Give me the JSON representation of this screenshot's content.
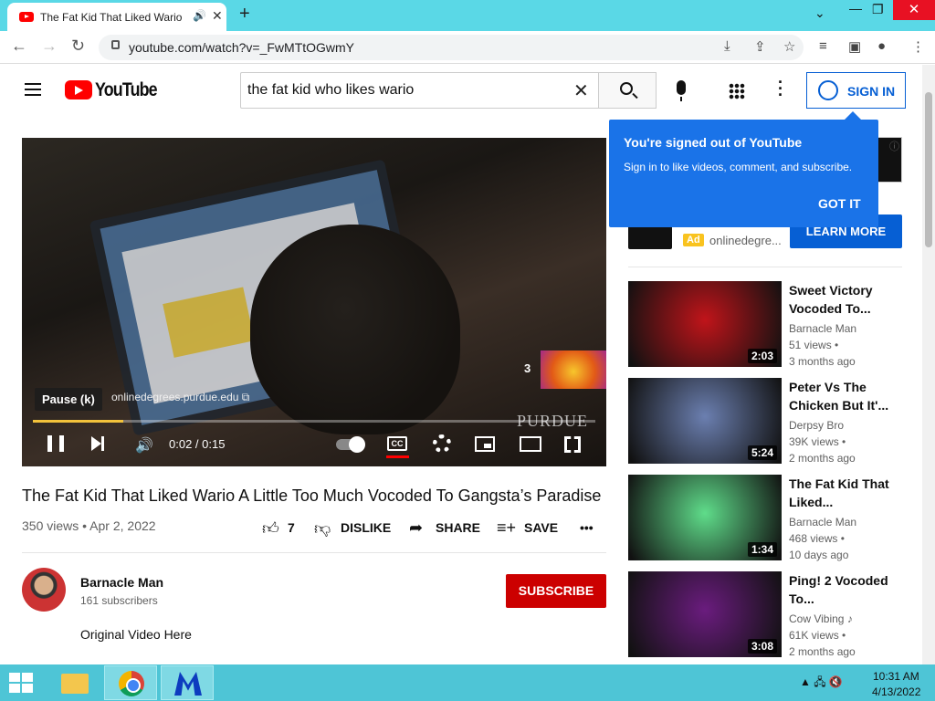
{
  "browser": {
    "tab_title": "The Fat Kid That Liked Wario",
    "tab_audio_icon": "speaker-icon",
    "new_tab_label": "+",
    "minimize_label": "—",
    "restore_label": "❐",
    "close_label": "✕",
    "url": "youtube.com/watch?v=_FwMTtOGwmY"
  },
  "youtube": {
    "logo_text": "YouTube",
    "search_value": "the fat kid who likes wario",
    "sign_in_label": "SIGN IN"
  },
  "player": {
    "tooltip": "Pause (k)",
    "ad_link": "onlinedegrees.purdue.edu ⧉",
    "watermark": "PURDUE",
    "upnext_count": "3",
    "time": "0:02 / 0:15",
    "progress_fraction": 0.16,
    "cc_label": "CC"
  },
  "video": {
    "title": "The Fat Kid That Liked Wario A Little Too Much Vocoded To Gangsta’s Paradise",
    "meta": "350 views • Apr 2, 2022",
    "like_count": "7",
    "dislike_label": "DISLIKE",
    "share_label": "SHARE",
    "save_label": "SAVE",
    "more_label": "•••"
  },
  "channel": {
    "name": "Barnacle Man",
    "subs": "161 subscribers",
    "subscribe_label": "SUBSCRIBE",
    "description": "Original Video Here"
  },
  "popup": {
    "title": "You're signed out of YouTube",
    "body": "Sign in to like videos, comment, and subscribe.",
    "button": "GOT IT"
  },
  "ad": {
    "badge": "Ad",
    "domain": "onlinedegre...",
    "cta": "LEARN MORE",
    "info_icon": "ⓘ"
  },
  "recommendations": [
    {
      "title": "Sweet Victory Vocoded To...",
      "channel": "Barnacle Man",
      "views": "51 views •",
      "age": "3 months ago",
      "duration": "2:03",
      "thumb_color": "#c0141a"
    },
    {
      "title": "Peter Vs The Chicken But It'...",
      "channel": "Derpsy Bro",
      "views": "39K views •",
      "age": "2 months ago",
      "duration": "5:24",
      "thumb_color": "#6b7fb0"
    },
    {
      "title": "The Fat Kid That Liked...",
      "channel": "Barnacle Man",
      "views": "468 views •",
      "age": "10 days ago",
      "duration": "1:34",
      "thumb_color": "#5fdc8a"
    },
    {
      "title": "Ping! 2 Vocoded To...",
      "channel": "Cow Vibing ♪",
      "views": "61K views •",
      "age": "2 months ago",
      "duration": "3:08",
      "thumb_color": "#6a1c7e"
    }
  ],
  "taskbar": {
    "time": "10:31 AM",
    "date": "4/13/2022",
    "tray_icons": "▲ 🖧 🔇"
  }
}
